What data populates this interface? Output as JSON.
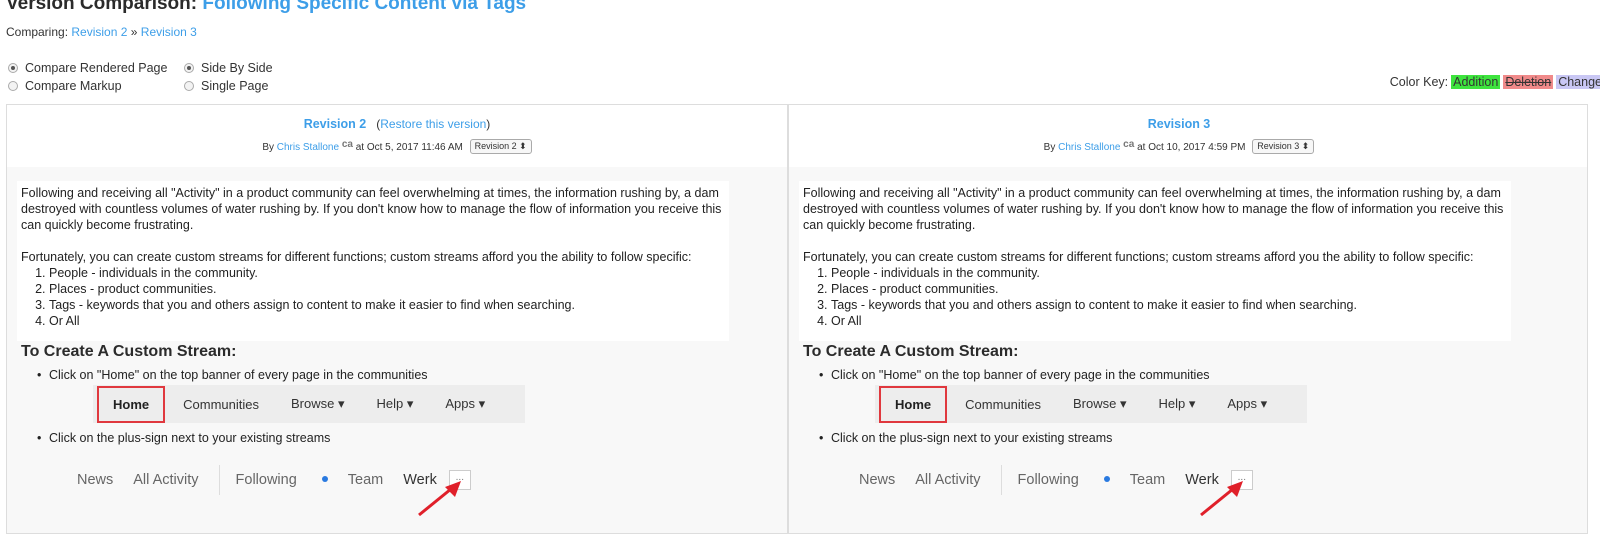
{
  "header": {
    "title_prefix": "Version Comparison:",
    "title_subject": "Following Specific Content via Tags",
    "comparing_label": "Comparing:",
    "rev_from": "Revision 2",
    "separator": "»",
    "rev_to": "Revision 3"
  },
  "options": {
    "compare_rendered": "Compare Rendered Page",
    "compare_markup": "Compare Markup",
    "side_by_side": "Side By Side",
    "single_page": "Single Page",
    "selected_mode": "Compare Rendered Page",
    "selected_layout": "Side By Side"
  },
  "color_key": {
    "label": "Color Key:",
    "addition": "Addition",
    "deletion": "Deletion",
    "change": "Change",
    "colors": {
      "addition": "#3ee43e",
      "deletion": "#f08a8a",
      "change": "#c9c7f4"
    }
  },
  "left": {
    "revision_title": "Revision 2",
    "restore_open": "(",
    "restore_link": "Restore this version",
    "restore_close": ")",
    "by": "By",
    "author": "Chris Stallone",
    "author_badge": "ca",
    "at": "at Oct 5, 2017 11:46 AM",
    "select_value": "Revision 2 ⬍"
  },
  "right": {
    "revision_title": "Revision 3",
    "by": "By",
    "author": "Chris Stallone",
    "author_badge": "ca",
    "at": "at Oct 10, 2017 4:59 PM",
    "select_value": "Revision 3 ⬍"
  },
  "content": {
    "para1": "Following and receiving all \"Activity\" in a product community can feel overwhelming at times, the information rushing by, a dam destroyed with countless volumes of water rushing by. If you don't know how to manage the flow of information you receive this can quickly become frustrating.",
    "para2": "Fortunately, you can create custom streams for different functions; custom streams afford you the ability to follow specific:",
    "list": [
      "People - individuals in the community.",
      "Places - product communities.",
      "Tags - keywords that you and others assign to content to make it easier to find when searching.",
      "Or All"
    ],
    "heading": "To Create A Custom Stream:",
    "bullet1": "Click on \"Home\" on the top banner of every page in the communities",
    "bullet2": "Click on the plus-sign  next to your existing streams",
    "nav": [
      "Home",
      "Communities",
      "Browse ▾",
      "Help ▾",
      "Apps ▾"
    ],
    "streams": [
      "News",
      "All Activity",
      "Following",
      "Team",
      "Werk"
    ],
    "plus_box": "..."
  }
}
